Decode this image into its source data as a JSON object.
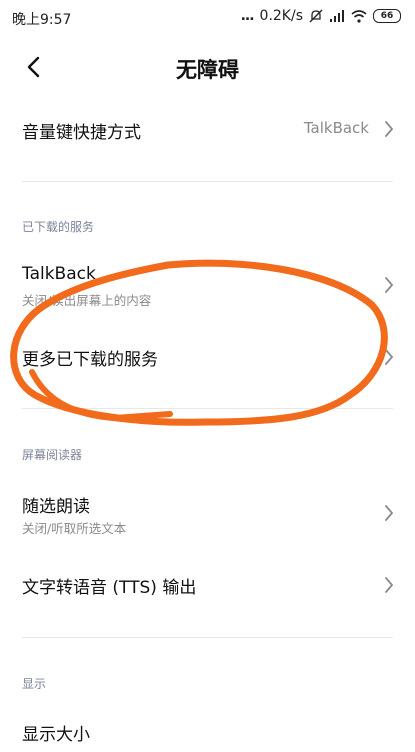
{
  "status": {
    "time": "晚上9:57",
    "network_speed": "0.2K/s",
    "battery": "66"
  },
  "header": {
    "title": "无障碍"
  },
  "items": {
    "volume_shortcut": {
      "label": "音量键快捷方式",
      "value": "TalkBack"
    },
    "talkback": {
      "label": "TalkBack",
      "sub": "关闭/读出屏幕上的内容"
    },
    "more_services": {
      "label": "更多已下载的服务"
    },
    "select_to_speak": {
      "label": "随选朗读",
      "sub": "关闭/听取所选文本"
    },
    "tts_output": {
      "label": "文字转语音 (TTS) 输出"
    },
    "display_size": {
      "label": "显示大小"
    }
  },
  "sections": {
    "downloaded": "已下载的服务",
    "screen_reader": "屏幕阅读器",
    "display": "显示"
  },
  "colors": {
    "annotation": "#f26a1b",
    "section_text": "#7d8599"
  }
}
